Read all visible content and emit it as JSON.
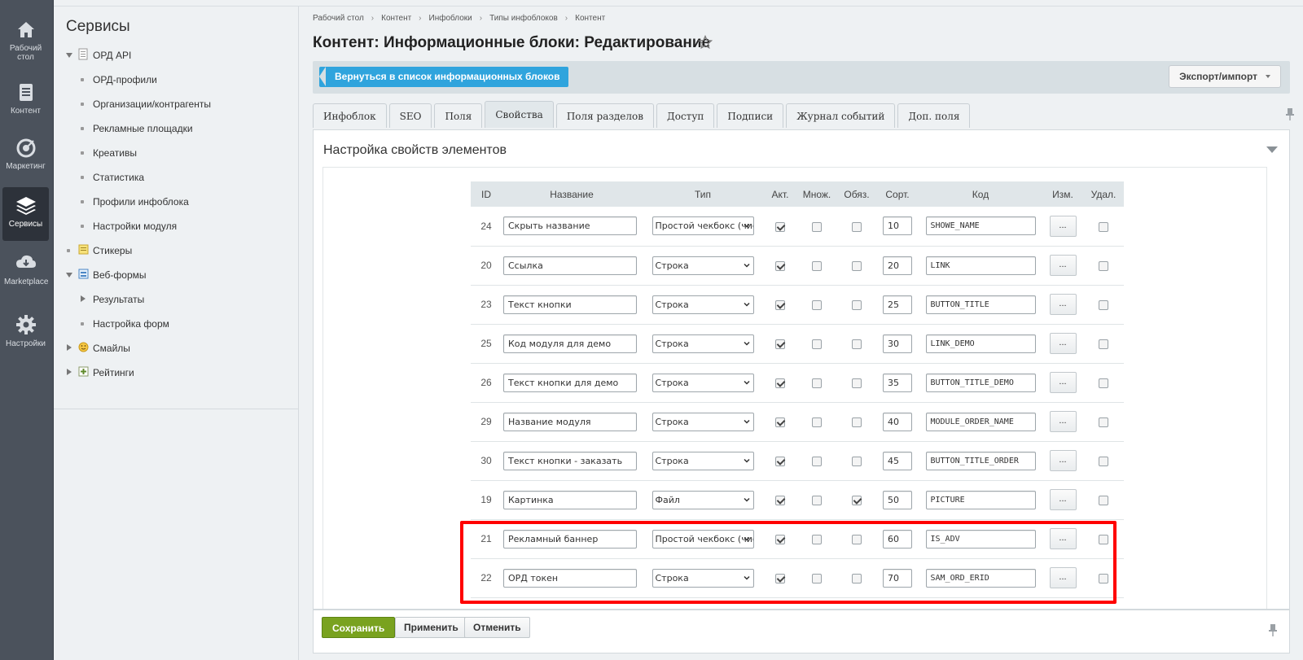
{
  "iconbar": {
    "items": [
      {
        "label": "Рабочий стол",
        "icon": "home-icon"
      },
      {
        "label": "Контент",
        "icon": "document-icon"
      },
      {
        "label": "Маркетинг",
        "icon": "target-icon"
      },
      {
        "label": "Сервисы",
        "icon": "layers-icon"
      },
      {
        "label": "Marketplace",
        "icon": "cloud-download-icon"
      },
      {
        "label": "Настройки",
        "icon": "gear-icon"
      }
    ]
  },
  "submenu": {
    "title": "Сервисы",
    "items": [
      {
        "label": "ОРД API"
      },
      {
        "label": "ОРД-профили"
      },
      {
        "label": "Организации/контрагенты"
      },
      {
        "label": "Рекламные площадки"
      },
      {
        "label": "Креативы"
      },
      {
        "label": "Статистика"
      },
      {
        "label": "Профили инфоблока"
      },
      {
        "label": "Настройки модуля"
      },
      {
        "label": "Стикеры"
      },
      {
        "label": "Веб-формы"
      },
      {
        "label": "Результаты"
      },
      {
        "label": "Настройка форм"
      },
      {
        "label": "Смайлы"
      },
      {
        "label": "Рейтинги"
      }
    ]
  },
  "breadcrumbs": [
    "Рабочий стол",
    "Контент",
    "Инфоблоки",
    "Типы инфоблоков",
    "Контент"
  ],
  "page_title": "Контент: Информационные блоки: Редактирование",
  "toolbar": {
    "back_label": "Вернуться в список информационных блоков",
    "export_label": "Экспорт/импорт"
  },
  "tabs": [
    "Инфоблок",
    "SEO",
    "Поля",
    "Свойства",
    "Поля разделов",
    "Доступ",
    "Подписи",
    "Журнал событий",
    "Доп. поля"
  ],
  "active_tab": "Свойства",
  "panel_title": "Настройка свойств элементов",
  "table": {
    "headers": {
      "id": "ID",
      "name": "Название",
      "type": "Тип",
      "active": "Акт.",
      "multiple": "Множ.",
      "required": "Обяз.",
      "sort": "Сорт.",
      "code": "Код",
      "edit": "Изм.",
      "delete": "Удал."
    },
    "edit_label": "...",
    "rows": [
      {
        "id": "24",
        "name": "Скрыть название",
        "type": "Простой чекбокс (чис",
        "active": true,
        "multiple": false,
        "required": false,
        "sort": "10",
        "code": "SHOWE_NAME"
      },
      {
        "id": "20",
        "name": "Ссылка",
        "type": "Строка",
        "active": true,
        "multiple": false,
        "required": false,
        "sort": "20",
        "code": "LINK"
      },
      {
        "id": "23",
        "name": "Текст кнопки",
        "type": "Строка",
        "active": true,
        "multiple": false,
        "required": false,
        "sort": "25",
        "code": "BUTTON_TITLE"
      },
      {
        "id": "25",
        "name": "Код модуля для демо",
        "type": "Строка",
        "active": true,
        "multiple": false,
        "required": false,
        "sort": "30",
        "code": "LINK_DEMO"
      },
      {
        "id": "26",
        "name": "Текст кнопки для демо",
        "type": "Строка",
        "active": true,
        "multiple": false,
        "required": false,
        "sort": "35",
        "code": "BUTTON_TITLE_DEMO"
      },
      {
        "id": "29",
        "name": "Название модуля",
        "type": "Строка",
        "active": true,
        "multiple": false,
        "required": false,
        "sort": "40",
        "code": "MODULE_ORDER_NAME"
      },
      {
        "id": "30",
        "name": "Текст кнопки - заказать",
        "type": "Строка",
        "active": true,
        "multiple": false,
        "required": false,
        "sort": "45",
        "code": "BUTTON_TITLE_ORDER"
      },
      {
        "id": "19",
        "name": "Картинка",
        "type": "Файл",
        "active": true,
        "multiple": false,
        "required": true,
        "sort": "50",
        "code": "PICTURE"
      },
      {
        "id": "21",
        "name": "Рекламный баннер",
        "type": "Простой чекбокс (чис",
        "active": true,
        "multiple": false,
        "required": false,
        "sort": "60",
        "code": "IS_ADV"
      },
      {
        "id": "22",
        "name": "ОРД токен",
        "type": "Строка",
        "active": true,
        "multiple": false,
        "required": false,
        "sort": "70",
        "code": "SAM_ORD_ERID"
      }
    ]
  },
  "footer": {
    "save_label": "Сохранить",
    "apply_label": "Применить",
    "cancel_label": "Отменить"
  },
  "colors": {
    "accent_blue": "#2fa4dd",
    "save_green": "#79a21f",
    "highlight_red": "#ff0000",
    "sidebar_dark": "#4b525c"
  }
}
